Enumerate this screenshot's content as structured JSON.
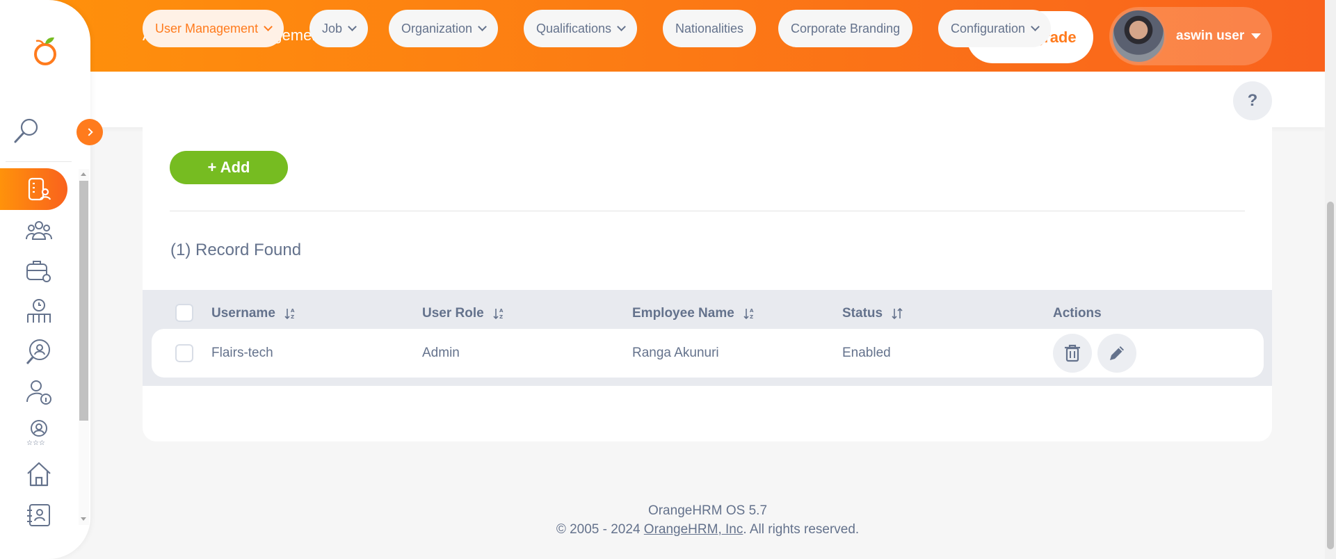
{
  "header": {
    "breadcrumb": "Admin / User Management",
    "upgrade_label": "Upgrade",
    "user_name": "aswin user"
  },
  "topnav": {
    "tabs": [
      {
        "label": "User Management",
        "dropdown": true,
        "active": true
      },
      {
        "label": "Job",
        "dropdown": true
      },
      {
        "label": "Organization",
        "dropdown": true
      },
      {
        "label": "Qualifications",
        "dropdown": true
      },
      {
        "label": "Nationalities",
        "dropdown": false
      },
      {
        "label": "Corporate Branding",
        "dropdown": false
      },
      {
        "label": "Configuration",
        "dropdown": true
      }
    ],
    "help_label": "?"
  },
  "sidebar": {
    "items": [
      "admin-icon",
      "pim-icon",
      "leave-icon",
      "time-icon",
      "recruitment-icon",
      "my-info-icon",
      "performance-icon",
      "dashboard-icon",
      "directory-icon"
    ]
  },
  "main": {
    "add_label": "+ Add",
    "records_found": "(1) Record Found",
    "columns": [
      "Username",
      "User Role",
      "Employee Name",
      "Status",
      "Actions"
    ],
    "rows": [
      {
        "username": "Flairs-tech",
        "role": "Admin",
        "employee": "Ranga Akunuri",
        "status": "Enabled"
      }
    ]
  },
  "footer": {
    "version": "OrangeHRM OS 5.7",
    "copyright_prefix": "© 2005 - 2024 ",
    "company_link": "OrangeHRM, Inc",
    "copyright_suffix": ". All rights reserved."
  },
  "colors": {
    "brand_orange": "#ff7b1d",
    "add_green": "#76bc21",
    "text": "#64728c"
  }
}
